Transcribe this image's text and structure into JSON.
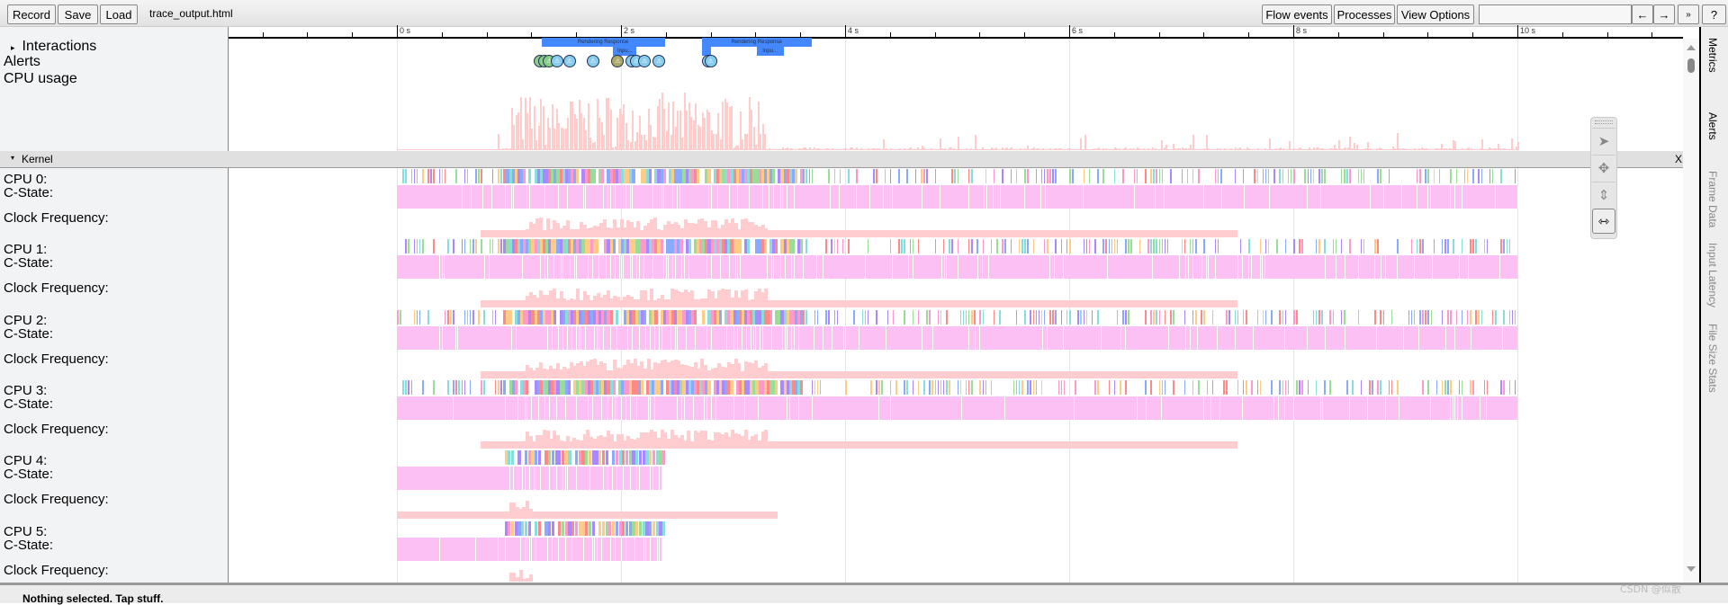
{
  "toolbar": {
    "record": "Record",
    "save": "Save",
    "load": "Load",
    "title": "trace_output.html",
    "flow_events": "Flow events",
    "processes": "Processes",
    "view_options": "View Options",
    "search_value": "",
    "prev": "←",
    "next": "→",
    "more": "»",
    "help": "?"
  },
  "ruler": {
    "unit": "s",
    "major_labels": [
      "0 s",
      "2 s",
      "4 s",
      "6 s",
      "8 s",
      "10 s"
    ]
  },
  "tracks": {
    "interactions": "Interactions",
    "alerts": "Alerts",
    "cpu_usage": "CPU usage",
    "kernel": "Kernel",
    "kernel_close": "X"
  },
  "interactions": [
    {
      "label": "Rendering Response",
      "start": 1.29,
      "end": 2.39,
      "row": 0
    },
    {
      "label": "Inpu...",
      "start": 1.93,
      "end": 2.14,
      "row": 1
    },
    {
      "label": "Rendering Response",
      "start": 2.72,
      "end": 3.7,
      "row": 0
    },
    {
      "label": "",
      "start": 2.72,
      "end": 2.8,
      "row": 1
    },
    {
      "label": "Inpu...",
      "start": 3.21,
      "end": 3.45,
      "row": 1
    }
  ],
  "alerts": [
    {
      "t": 1.28,
      "color": "#88cc88"
    },
    {
      "t": 1.32,
      "color": "#88cc88"
    },
    {
      "t": 1.36,
      "color": "#88cc88"
    },
    {
      "t": 1.43,
      "color": "#88ccee"
    },
    {
      "t": 1.54,
      "color": "#88ccee"
    },
    {
      "t": 1.75,
      "color": "#88ccee"
    },
    {
      "t": 1.97,
      "color": "#aaaa66"
    },
    {
      "t": 2.1,
      "color": "#88ccee"
    },
    {
      "t": 2.14,
      "color": "#88ccee"
    },
    {
      "t": 2.21,
      "color": "#88ccee"
    },
    {
      "t": 2.34,
      "color": "#88ccee"
    },
    {
      "t": 2.78,
      "color": "#88ccee"
    },
    {
      "t": 2.8,
      "color": "#88ccee"
    }
  ],
  "cpus": [
    {
      "label": "CPU 0:",
      "cstate": "C-State:",
      "freq": "Clock Frequency:",
      "end": 10
    },
    {
      "label": "CPU 1:",
      "cstate": "C-State:",
      "freq": "Clock Frequency:",
      "end": 10
    },
    {
      "label": "CPU 2:",
      "cstate": "C-State:",
      "freq": "Clock Frequency:",
      "end": 10
    },
    {
      "label": "CPU 3:",
      "cstate": "C-State:",
      "freq": "Clock Frequency:",
      "end": 10
    },
    {
      "label": "CPU 4:",
      "cstate": "C-State:",
      "freq": "Clock Frequency:",
      "end": 2.37
    },
    {
      "label": "CPU 5:",
      "cstate": "C-State:",
      "freq": "Clock Frequency:",
      "end": 2.37
    }
  ],
  "sidebar": {
    "tabs": [
      "Metrics",
      "Alerts",
      "Frame Data",
      "Input Latency",
      "File Size Stats"
    ]
  },
  "bottom": {
    "status": "Nothing selected. Tap stuff."
  },
  "watermark": "CSDN @似散",
  "colors": {
    "cpu_usage": "#ffcccc",
    "cstate": "#fcc0f4",
    "freq": "#ffccd0",
    "interaction": "#4488ff"
  }
}
